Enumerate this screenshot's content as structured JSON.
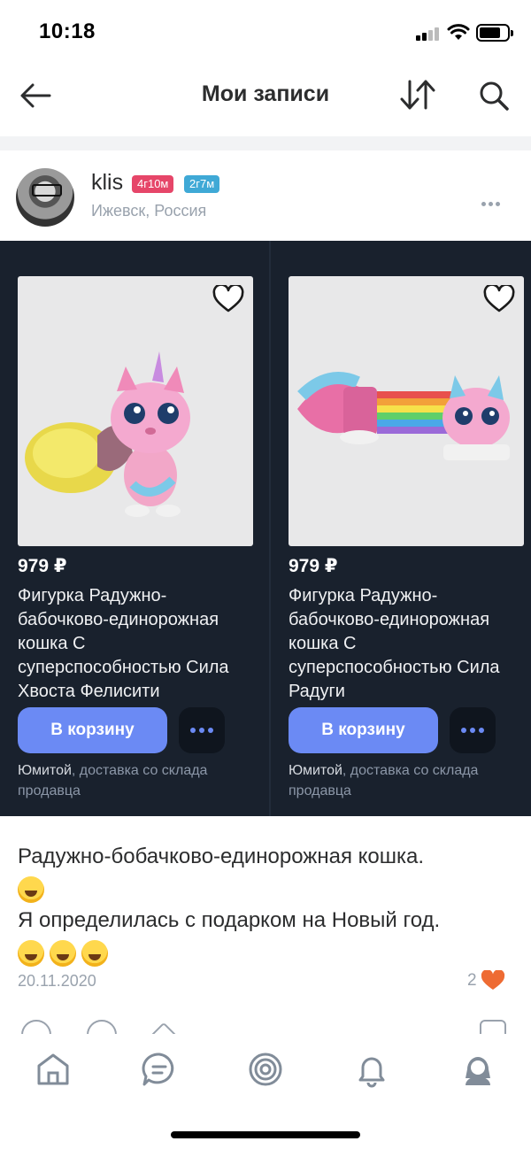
{
  "status_bar": {
    "time": "10:18"
  },
  "header": {
    "title": "Мои записи"
  },
  "author": {
    "name": "klis",
    "badge_1": "4г10м",
    "badge_2": "2г7м",
    "location": "Ижевск, Россия"
  },
  "products": [
    {
      "price": "979 ₽",
      "name": "Фигурка Радужно-бабочково-единорожная кошка С суперспособностью Сила Хвоста Фелисити",
      "cart_label": "В корзину",
      "seller": "Юмитой",
      "delivery": ", доставка со склада продавца"
    },
    {
      "price": "979 ₽",
      "name": "Фигурка Радужно-бабочково-единорожная кошка С суперспособностью Сила Радуги",
      "cart_label": "В корзину",
      "seller": "Юмитой",
      "delivery": ", доставка со склада продавца"
    }
  ],
  "post": {
    "line1": "Радужно-бобачково-единорожная кошка.",
    "line2": "Я определилась с подарком на Новый год.",
    "date": "20.11.2020",
    "likes": "2"
  },
  "colors": {
    "accent": "#6b8af4",
    "product_bg": "#19212d",
    "badge_pink": "#e64669",
    "badge_blue": "#3fa9d6",
    "like_heart": "#ee6b33"
  },
  "tabbar": {
    "icons": [
      "home-icon",
      "messages-icon",
      "discover-icon",
      "notifications-icon",
      "profile-icon"
    ]
  }
}
